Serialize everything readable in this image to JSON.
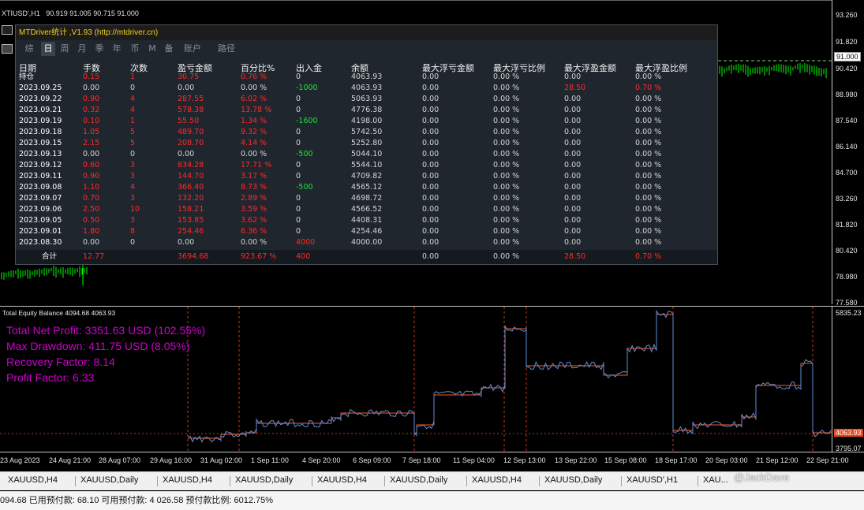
{
  "chart_header": {
    "symbol": "XTIUSD',H1",
    "ohlc": "90.919 91.005 90.715 91.000"
  },
  "price_axis": {
    "labels": [
      "93.260",
      "91.820",
      "90.420",
      "88.980",
      "87.540",
      "86.140",
      "84.700",
      "83.260",
      "81.820",
      "80.420",
      "78.980",
      "77.580"
    ],
    "current": "91.000"
  },
  "panel": {
    "title": "MTDriver统计 ,V1.93 (http://mtdriver.cn)",
    "tabs": [
      "综",
      "日",
      "周",
      "月",
      "季",
      "年",
      "币",
      "M",
      "备",
      "账户",
      "路径"
    ],
    "active_tab": 1,
    "headers": [
      "日期",
      "手数",
      "次数",
      "盈亏金额",
      "百分比%",
      "出入金",
      "余额",
      "最大浮亏金额",
      "最大浮亏比例",
      "最大浮盈金额",
      "最大浮盈比例"
    ],
    "rows": [
      [
        "持仓",
        "0.15",
        "1",
        "30.75",
        "0.76 %",
        "0",
        "4063.93",
        "0.00",
        "0.00 %",
        "0.00",
        "0.00 %"
      ],
      [
        "2023.09.25",
        "0.00",
        "0",
        "0.00",
        "0.00 %",
        "-1000",
        "4063.93",
        "0.00",
        "0.00 %",
        "28.50",
        "0.70 %"
      ],
      [
        "2023.09.22",
        "0.90",
        "4",
        "287.55",
        "6.02 %",
        "0",
        "5063.93",
        "0.00",
        "0.00 %",
        "0.00",
        "0.00 %"
      ],
      [
        "2023.09.21",
        "0.32",
        "4",
        "578.38",
        "13.78 %",
        "0",
        "4776.38",
        "0.00",
        "0.00 %",
        "0.00",
        "0.00 %"
      ],
      [
        "2023.09.19",
        "0.10",
        "1",
        "55.50",
        "1.34 %",
        "-1600",
        "4198.00",
        "0.00",
        "0.00 %",
        "0.00",
        "0.00 %"
      ],
      [
        "2023.09.18",
        "1.05",
        "5",
        "489.70",
        "9.32 %",
        "0",
        "5742.50",
        "0.00",
        "0.00 %",
        "0.00",
        "0.00 %"
      ],
      [
        "2023.09.15",
        "2.15",
        "5",
        "208.70",
        "4.14 %",
        "0",
        "5252.80",
        "0.00",
        "0.00 %",
        "0.00",
        "0.00 %"
      ],
      [
        "2023.09.13",
        "0.00",
        "0",
        "0.00",
        "0.00 %",
        "-500",
        "5044.10",
        "0.00",
        "0.00 %",
        "0.00",
        "0.00 %"
      ],
      [
        "2023.09.12",
        "0.60",
        "3",
        "834.28",
        "17.71 %",
        "0",
        "5544.10",
        "0.00",
        "0.00 %",
        "0.00",
        "0.00 %"
      ],
      [
        "2023.09.11",
        "0.90",
        "3",
        "144.70",
        "3.17 %",
        "0",
        "4709.82",
        "0.00",
        "0.00 %",
        "0.00",
        "0.00 %"
      ],
      [
        "2023.09.08",
        "1.10",
        "4",
        "366.40",
        "8.73 %",
        "-500",
        "4565.12",
        "0.00",
        "0.00 %",
        "0.00",
        "0.00 %"
      ],
      [
        "2023.09.07",
        "0.70",
        "3",
        "132.20",
        "2.89 %",
        "0",
        "4698.72",
        "0.00",
        "0.00 %",
        "0.00",
        "0.00 %"
      ],
      [
        "2023.09.06",
        "2.50",
        "10",
        "158.21",
        "3.59 %",
        "0",
        "4566.52",
        "0.00",
        "0.00 %",
        "0.00",
        "0.00 %"
      ],
      [
        "2023.09.05",
        "0.50",
        "3",
        "153.85",
        "3.62 %",
        "0",
        "4408.31",
        "0.00",
        "0.00 %",
        "0.00",
        "0.00 %"
      ],
      [
        "2023.09.01",
        "1.80",
        "8",
        "254.46",
        "6.36 %",
        "0",
        "4254.46",
        "0.00",
        "0.00 %",
        "0.00",
        "0.00 %"
      ],
      [
        "2023.08.30",
        "0.00",
        "0",
        "0.00",
        "0.00 %",
        "4000",
        "4000.00",
        "0.00",
        "0.00 %",
        "0.00",
        "0.00 %"
      ]
    ],
    "total": [
      "合计",
      "12.77",
      "",
      "3694.68",
      "923.67 %",
      "400",
      "",
      "0.00",
      "0.00 %",
      "28.50",
      "0.70 %"
    ]
  },
  "equity": {
    "title": "Total Equity Balance 4094.68 4063.93",
    "stats": [
      "Total Net Profit: 3351.63 USD (102.55%)",
      "Max Drawdown: 411.75 USD (8.05%)",
      "Recovery Factor: 8.14",
      "Profit Factor: 6.33"
    ],
    "axis_top": "5835.23",
    "axis_bottom": "3795.07",
    "current": "4063.93"
  },
  "time_axis": [
    "23 Aug 2023",
    "24 Aug 21:00",
    "28 Aug 07:00",
    "29 Aug 16:00",
    "31 Aug 02:00",
    "1 Sep 11:00",
    "4 Sep 20:00",
    "6 Sep 09:00",
    "7 Sep 18:00",
    "11 Sep 04:00",
    "12 Sep 13:00",
    "13 Sep 22:00",
    "15 Sep 08:00",
    "18 Sep 17:00",
    "20 Sep 03:00",
    "21 Sep 12:00",
    "22 Sep 21:00"
  ],
  "bottom_tabs": [
    "XAUUSD,H4",
    "XAUUSD,Daily",
    "XAUUSD,H4",
    "XAUUSD,Daily",
    "XAUUSD,H4",
    "XAUUSD,Daily",
    "XAUUSD,H4",
    "XAUUSD,Daily",
    "XAUUSD',H1",
    "XAU..."
  ],
  "watermark": "@JackDave",
  "status": "094.68  已用预付款: 68.10  可用预付款: 4 026.58  预付款比例: 6012.75%",
  "colors": {
    "bull": "#00ff00",
    "equity": "#5f8fd8",
    "balance": "#ff5a1e",
    "stat_text": "#d000d0",
    "loss": "#ff2a2a",
    "inflow": "#1ee23a"
  }
}
